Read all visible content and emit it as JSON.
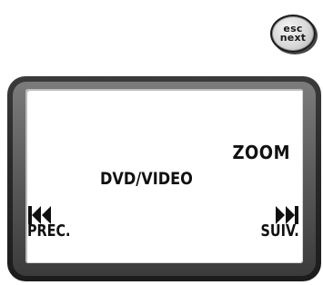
{
  "esc_button": {
    "line1": "esc",
    "line2": "next"
  },
  "screen": {
    "zoom_label": "ZOOM",
    "mode_label": "DVD/VIDEO",
    "prev": {
      "label": "PREC.",
      "icon": "skip-previous-icon"
    },
    "next": {
      "label": "SUIV.",
      "icon": "skip-next-icon"
    }
  },
  "colors": {
    "frame": "#2a2a2a",
    "frame_highlight": "#6a6a6a",
    "screen_bg": "#ffffff",
    "text": "#111111",
    "esc_button_bg": "#d8d8d8"
  }
}
